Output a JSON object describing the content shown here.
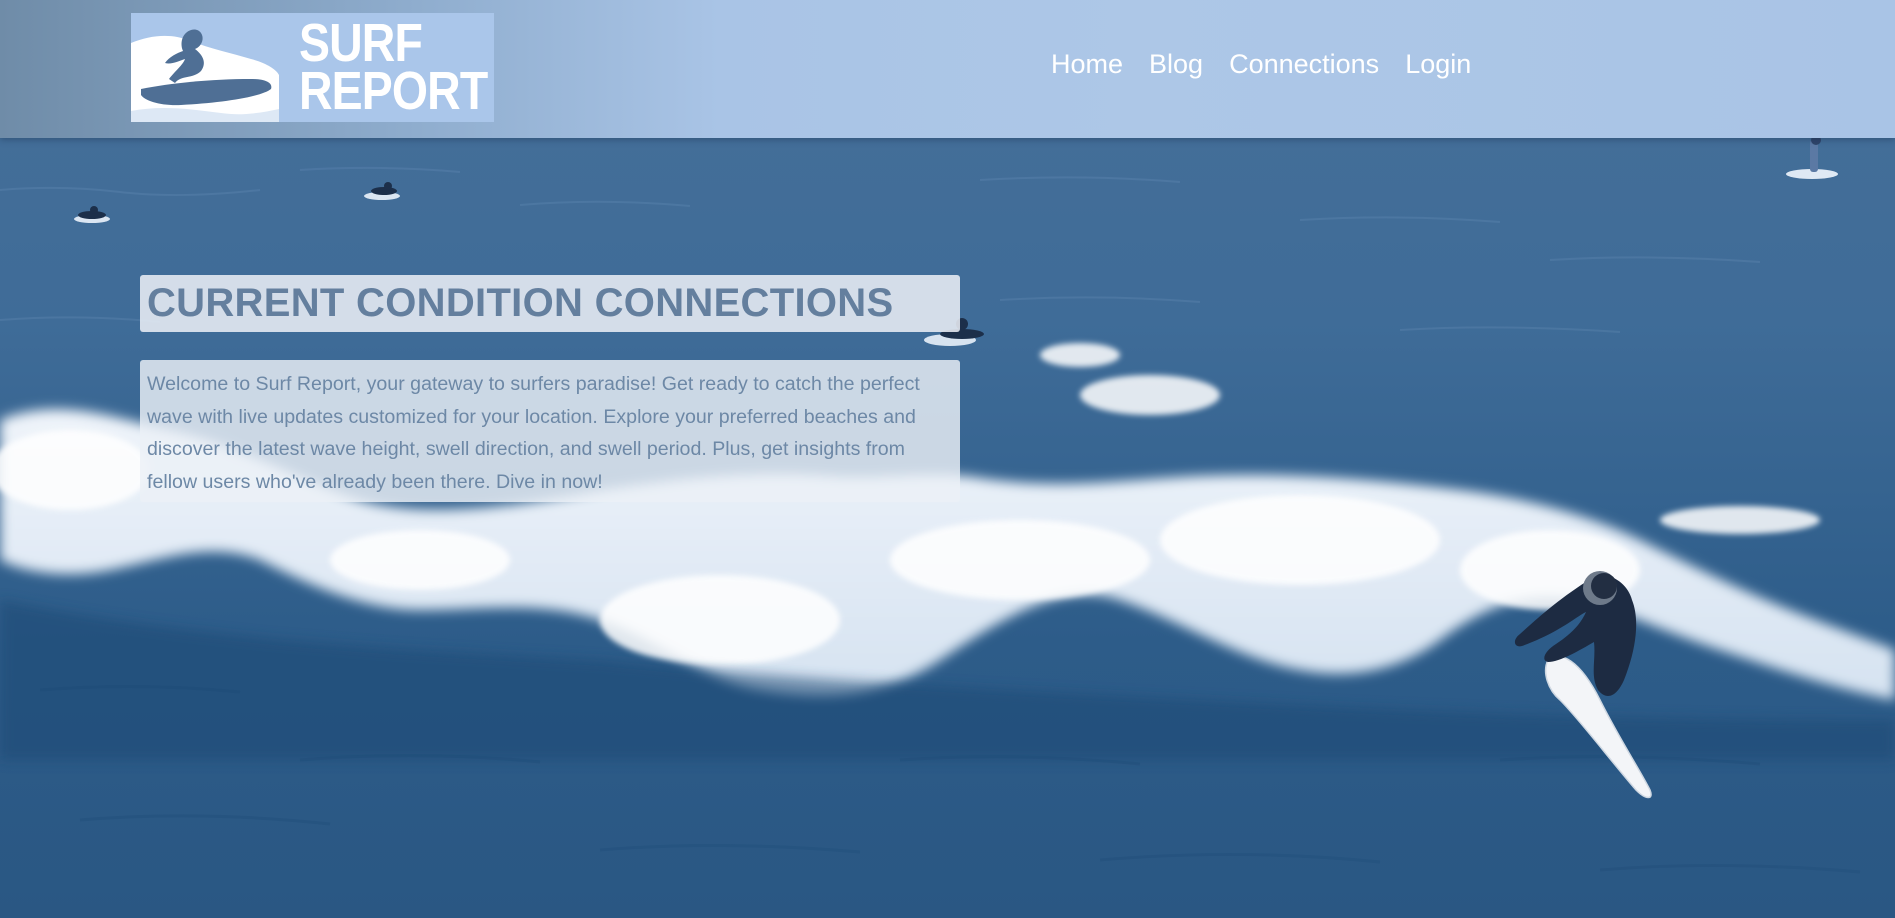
{
  "header": {
    "logo": {
      "line1": "SURF",
      "line2": "REPORT"
    },
    "nav": [
      {
        "label": "Home"
      },
      {
        "label": "Blog"
      },
      {
        "label": "Connections"
      },
      {
        "label": "Login"
      }
    ]
  },
  "main": {
    "headline": "CURRENT CONDITION CONNECTIONS",
    "intro": "Welcome to Surf Report, your gateway to surfers paradise! Get ready to catch the perfect wave with live updates customized for your location. Explore your preferred beaches and discover the latest wave height, swell direction, and swell period. Plus, get insights from fellow users who've already been there. Dive in now!"
  },
  "colors": {
    "header_bg": "#adc7e7",
    "logo_bg": "#aac6ea",
    "nav_text": "#ffffff",
    "headline_text": "#647f9e",
    "body_text": "#6d88a6",
    "ocean_deep": "#2b5a86",
    "ocean_mid": "#3e6f9d",
    "foam": "#ffffff"
  }
}
